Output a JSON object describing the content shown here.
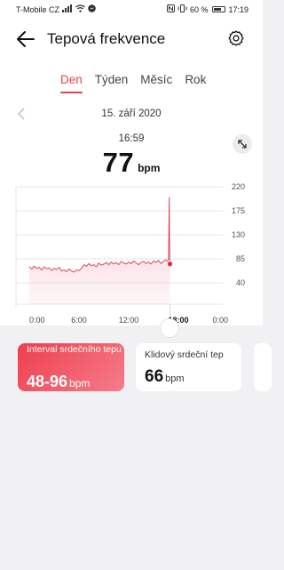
{
  "status_bar": {
    "carrier": "T-Mobile CZ",
    "battery": "60 %",
    "battery_level": 0.6,
    "time": "17:19"
  },
  "header": {
    "title": "Tepová frekvence",
    "icons": {
      "back": "arrow-left-icon",
      "settings": "gear-icon"
    }
  },
  "tabs": [
    {
      "label": "Den",
      "active": true
    },
    {
      "label": "Týden",
      "active": false
    },
    {
      "label": "Měsíc",
      "active": false
    },
    {
      "label": "Rok",
      "active": false
    }
  ],
  "date": "15. září 2020",
  "reading": {
    "time": "16:59",
    "value": "77",
    "unit": "bpm"
  },
  "colors": {
    "accent": "#e64545",
    "line": "#d94a60",
    "area": "#f7c6cf"
  },
  "chart_data": {
    "type": "area",
    "x_ticks": [
      "0:00",
      "6:00",
      "12:00",
      "18:00",
      "0:00"
    ],
    "x_tick_hours": [
      0,
      6,
      12,
      18,
      24
    ],
    "y_ticks": [
      "220",
      "175",
      "130",
      "85",
      "40"
    ],
    "y_tick_values": [
      220,
      175,
      130,
      85,
      40
    ],
    "ylim": [
      0,
      220
    ],
    "xlim": [
      0,
      24
    ],
    "highlight_x_label": "18:00",
    "selected_point": {
      "x": 16.98,
      "y": 77
    },
    "series": [
      {
        "x": [
          0,
          0.3,
          0.6,
          0.9,
          1.2,
          1.5,
          1.8,
          2.1,
          2.4,
          2.7,
          3.0,
          3.3,
          3.6,
          3.9,
          4.2,
          4.5,
          4.8,
          5.1,
          5.4,
          5.7,
          6.0,
          6.3,
          6.6,
          6.9,
          7.2,
          7.5,
          7.8,
          8.1,
          8.4,
          8.7,
          9.0,
          9.3,
          9.6,
          9.9,
          10.2,
          10.5,
          10.8,
          11.1,
          11.4,
          11.7,
          12.0,
          12.3,
          12.6,
          12.9,
          13.2,
          13.5,
          13.8,
          14.1,
          14.4,
          14.7,
          15.0,
          15.3,
          15.6,
          15.9,
          16.2,
          16.5,
          16.8,
          16.9,
          16.95,
          16.98
        ],
        "y": [
          70,
          66,
          71,
          67,
          69,
          64,
          70,
          66,
          68,
          63,
          67,
          65,
          69,
          62,
          64,
          61,
          66,
          62,
          60,
          64,
          63,
          67,
          74,
          71,
          76,
          72,
          74,
          70,
          77,
          73,
          75,
          78,
          74,
          79,
          75,
          78,
          74,
          80,
          77,
          75,
          79,
          76,
          81,
          77,
          74,
          78,
          80,
          76,
          79,
          75,
          81,
          78,
          82,
          76,
          80,
          83,
          79,
          200,
          86,
          77
        ]
      }
    ]
  },
  "cards": [
    {
      "label": "Interval srdečního tepu",
      "value": "48-96",
      "unit": "bpm"
    },
    {
      "label": "Klidový srdeční tep",
      "value": "66",
      "unit": "bpm"
    }
  ]
}
